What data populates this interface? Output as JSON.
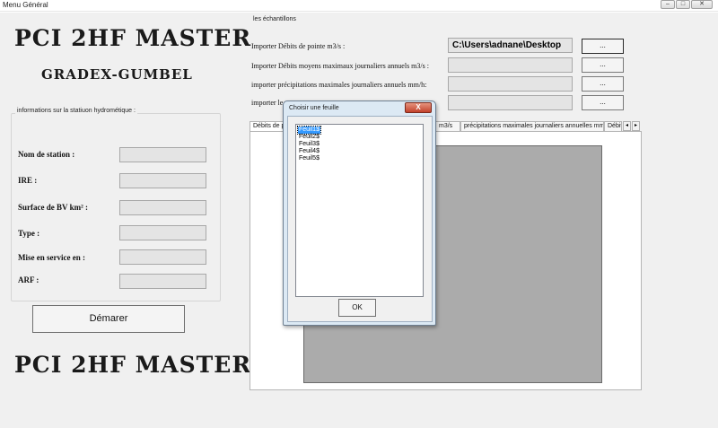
{
  "window": {
    "title": "Menu Général"
  },
  "left": {
    "logo_top": "PCI 2HF MASTER",
    "logo_sub": "GRADEX-GUMBEL",
    "logo_bottom": "PCI 2HF MASTER",
    "group_title": "informations sur la statiuon hydrométique :",
    "fields": [
      {
        "label": "Nom de station :",
        "value": ""
      },
      {
        "label": "IRE :",
        "value": ""
      },
      {
        "label": "Surface de BV km² :",
        "value": ""
      },
      {
        "label": "Type :",
        "value": ""
      },
      {
        "label": "Mise en service en :",
        "value": ""
      },
      {
        "label": "ARF :",
        "value": ""
      }
    ],
    "start_button": "Démarer"
  },
  "samples": {
    "group_title": "les échantillons",
    "rows": [
      {
        "label": "Importer Débits de pointe m3/s :",
        "path": "C:\\Users\\adnane\\Desktop",
        "button": "..."
      },
      {
        "label": "Importer Débits moyens maximaux journaliers annuels  m3/s :",
        "path": "",
        "button": "..."
      },
      {
        "label": "importer précipitations maximales journaliers annuels mm/h:",
        "path": "",
        "button": "..."
      },
      {
        "label": "importer le",
        "path": "",
        "button": "..."
      }
    ],
    "tabs": [
      {
        "label": "Débits de p"
      },
      {
        "label": "m3/s"
      },
      {
        "label": "précipitations maximales journaliers annuelles mm/h:"
      },
      {
        "label": "Débit"
      }
    ],
    "tab_scroll_left": "◂",
    "tab_scroll_right": "▸"
  },
  "dialog": {
    "title": "Choisir une feuille",
    "close": "X",
    "sheets": [
      "Feuil1$",
      "Feuil2$",
      "Feuil3$",
      "Feuil4$",
      "Feuil5$"
    ],
    "selected_index": 0,
    "ok_button": "OK"
  },
  "window_buttons": {
    "minimize": "–",
    "maximize": "□",
    "close": "✕"
  }
}
